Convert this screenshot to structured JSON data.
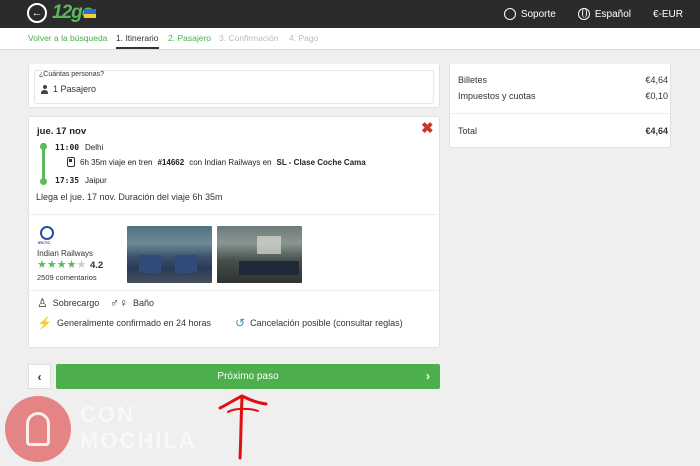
{
  "header": {
    "back_icon": "arrow-left-icon",
    "logo_text": "12go",
    "flag": "ukraine-flag",
    "support_label": "Soporte",
    "language_label": "Español",
    "currency_label": "€-EUR"
  },
  "steps": [
    {
      "label": "Volver a la búsqueda"
    },
    {
      "label": "1. Itinerario"
    },
    {
      "label": "2. Pasajero"
    },
    {
      "label": "3. Confirmación"
    },
    {
      "label": "4. Pago"
    }
  ],
  "persons": {
    "label": "¿Cuántas personas?",
    "value": "1 Pasajero"
  },
  "trip": {
    "date": "jue. 17 nov",
    "departure_time": "11:00",
    "departure_city": "Delhi",
    "duration_text": "6h 35m viaje en tren",
    "train_number": "#14662",
    "operator_text": "con Indian Railways en",
    "class_text": "SL - Clase Coche Cama",
    "arrival_time": "17:35",
    "arrival_city": "Jaipur",
    "arrival_summary": "Llega el jue. 17 nov. Duración del viaje 6h 35m"
  },
  "operator": {
    "logo_text": "IRCTC",
    "name": "Indian Railways",
    "stars": 4,
    "rating": "4.2",
    "reviews": "2509 comentarios"
  },
  "amenities": [
    {
      "label": "Sobrecargo",
      "icon": "attendant-icon"
    },
    {
      "label": "Baño",
      "icon": "restroom-icon"
    },
    {
      "label": "Generalmente confirmado en 24 horas",
      "icon": "no-instant-confirm-icon"
    },
    {
      "label": "Cancelación posible (consultar reglas)",
      "icon": "cancel-policy-icon"
    }
  ],
  "actions": {
    "next_label": "Próximo paso"
  },
  "summary": {
    "tickets_label": "Billetes",
    "tickets_value": "€4,64",
    "taxes_label": "Impuestos y cuotas",
    "taxes_value": "€0,10",
    "total_label": "Total",
    "total_value": "€4,64"
  },
  "watermark": {
    "line1": "CON",
    "line2": "MOCHILA"
  },
  "colors": {
    "accent_green": "#4cae4c",
    "topbar": "#2b2b2b",
    "close_red": "#c0392b",
    "annotation_red": "#e01010"
  }
}
